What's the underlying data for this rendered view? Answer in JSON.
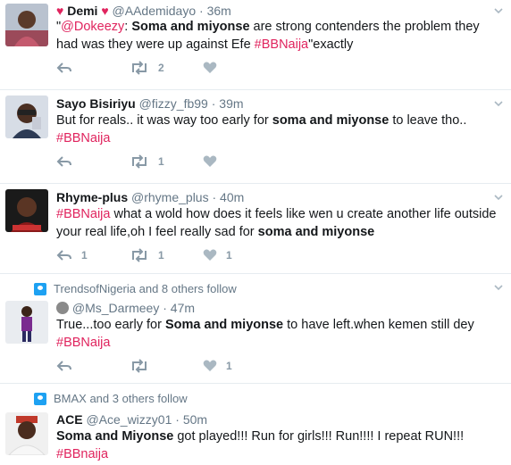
{
  "tweets": [
    {
      "name": "Demi",
      "handle": "@AAdemidayo",
      "time": "36m",
      "heart_left": "♥",
      "heart_right": "♥",
      "text_pre": "\"",
      "mention": "@Dokeezy",
      "text_colon": ": ",
      "bold": "Soma and miyonse",
      "text_mid": " are strong contenders the problem they had was they were up against Efe ",
      "hashtag": "#BBNaija",
      "text_end": "\"exactly",
      "retweets": "2",
      "replies": "",
      "likes": ""
    },
    {
      "name": "Sayo Bisiriyu",
      "handle": "@fizzy_fb99",
      "time": "39m",
      "text_pre": "But for reals.. it was way too early for ",
      "bold": "soma and miyonse",
      "text_mid": " to leave tho..",
      "hashtag": "#BBNaija",
      "retweets": "1",
      "likes": ""
    },
    {
      "name": "Rhyme-plus",
      "handle": "@rhyme_plus",
      "time": "40m",
      "hashtag": "#BBNaija",
      "text_mid": " what a wold how does it feels like wen u create another life outside your real life,oh I feel really sad for ",
      "bold": "soma and miyonse",
      "replies": "1",
      "retweets": "1",
      "likes": "1"
    },
    {
      "context": "TrendsofNigeria and 8 others follow",
      "name": "",
      "handle": "@Ms_Darmeey",
      "time": "47m",
      "text_pre": "True...too early for ",
      "bold": "Soma and miyonse",
      "text_mid": " to have left.when kemen still dey",
      "hashtag": "#BBNaija",
      "likes": "1"
    },
    {
      "context": "BMAX and 3 others follow",
      "name": "ACE",
      "handle": "@Ace_wizzy01",
      "time": "50m",
      "bold": "Soma and Miyonse",
      "text_mid": " got played!!! Run for girls!!! Run!!!! I repeat RUN!!!",
      "hashtag": "#BBnaija"
    }
  ],
  "colors": {
    "accent": "#e0245e",
    "muted": "#657786",
    "icon": "#8899a6"
  },
  "icons": [
    "reply-icon",
    "retweet-icon",
    "like-icon",
    "caret-down-icon",
    "follow-context-icon"
  ]
}
